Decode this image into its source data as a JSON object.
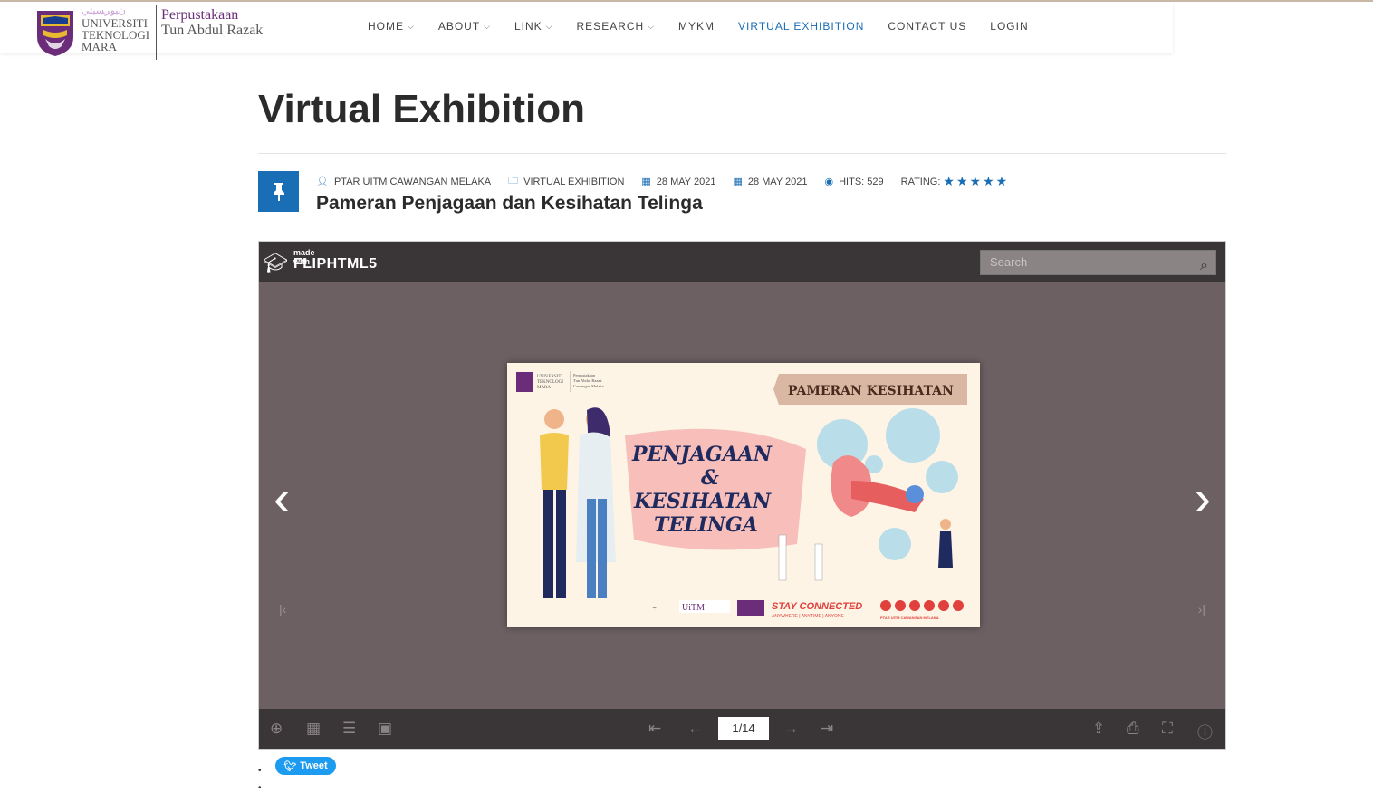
{
  "header": {
    "logo_university": [
      "UNIVERSITI",
      "TEKNOLOGI",
      "MARA"
    ],
    "logo_library": [
      "Perpustakaan",
      "Tun Abdul Razak"
    ],
    "nav": [
      {
        "label": "HOME",
        "has_dropdown": true
      },
      {
        "label": "ABOUT",
        "has_dropdown": true
      },
      {
        "label": "LINK",
        "has_dropdown": true
      },
      {
        "label": "RESEARCH",
        "has_dropdown": true
      },
      {
        "label": "MYKM",
        "has_dropdown": false
      },
      {
        "label": "VIRTUAL EXHIBITION",
        "has_dropdown": false,
        "active": true
      },
      {
        "label": "CONTACT US",
        "has_dropdown": false
      },
      {
        "label": "LOGIN",
        "has_dropdown": false
      }
    ],
    "accent_color": "#1a6eb5"
  },
  "page": {
    "title": "Virtual Exhibition"
  },
  "article": {
    "author": "PTAR UITM CAWANGAN MELAKA",
    "category": "VIRTUAL EXHIBITION",
    "date_created": "28 MAY 2021",
    "date_published": "28 MAY 2021",
    "hits": "HITS: 529",
    "rating_label": "RATING:",
    "rating_stars": "★★★★★",
    "title": "Pameran Penjagaan dan Kesihatan Telinga"
  },
  "viewer": {
    "made_with": "made with",
    "brand": "FLIPHTML5",
    "search_placeholder": "Search",
    "page_indicator": "1/14",
    "cover": {
      "banner": "PAMERAN KESIHATAN",
      "headline": [
        "PENJAGAAN",
        "&",
        "KESIHATAN",
        "TELINGA"
      ],
      "footer_left": "STAY CONNECTED",
      "footer_sub": "ANYWHERE | ANYTIME | ANYONE",
      "footer_right": "PTAR UITM CAWANGAN MELAKA",
      "uitm": "UiTM",
      "logo_lines": [
        "UNIVERSITI",
        "TEKNOLOGI",
        "MARA"
      ],
      "logo_library": [
        "Perpustakaan",
        "Tun Abdul Razak",
        "Cawangan Melaka"
      ]
    }
  },
  "social": {
    "tweet_label": "Tweet"
  }
}
